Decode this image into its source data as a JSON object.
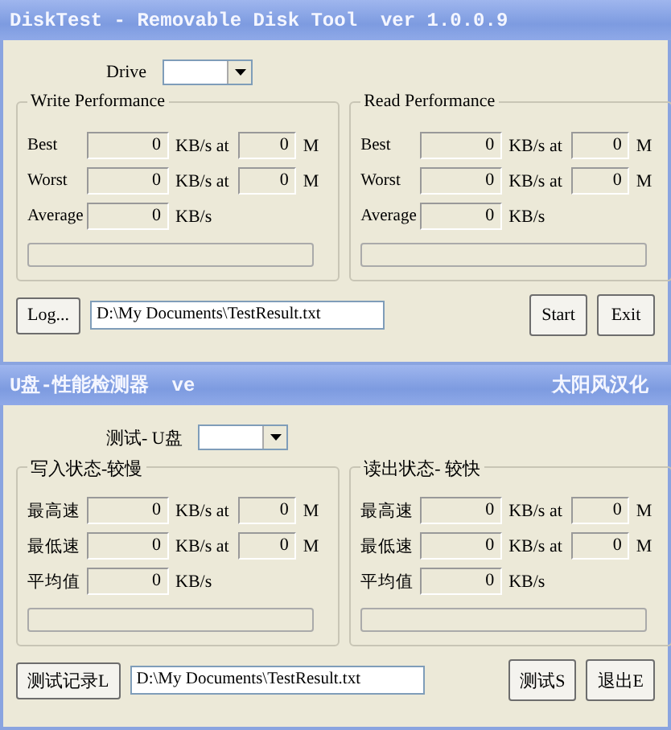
{
  "windows": [
    {
      "title": "DiskTest - Removable Disk Tool  ver 1.0.0.9",
      "drive_label": "Drive",
      "groups": [
        {
          "title": "Write Performance",
          "rows": [
            {
              "label": "Best",
              "value": "0",
              "unit": "KB/s at",
              "at_value": "0",
              "at_unit": "M"
            },
            {
              "label": "Worst",
              "value": "0",
              "unit": "KB/s at",
              "at_value": "0",
              "at_unit": "M"
            },
            {
              "label": "Average",
              "value": "0",
              "unit": "KB/s"
            }
          ],
          "progress": {
            "level": 0
          }
        },
        {
          "title": "Read Performance",
          "rows": [
            {
              "label": "Best",
              "value": "0",
              "unit": "KB/s at",
              "at_value": "0",
              "at_unit": "M"
            },
            {
              "label": "Worst",
              "value": "0",
              "unit": "KB/s at",
              "at_value": "0",
              "at_unit": "M"
            },
            {
              "label": "Average",
              "value": "0",
              "unit": "KB/s"
            }
          ],
          "progress": {
            "level": 0
          }
        }
      ],
      "log_button": "Log...",
      "log_path": "D:\\My Documents\\TestResult.txt",
      "buttons": [
        "Start",
        "Exit"
      ]
    },
    {
      "title": "U盘-性能检测器  ve",
      "title_right": "太阳风汉化",
      "drive_label": "测试- U盘",
      "groups": [
        {
          "title": "写入状态-较慢",
          "rows": [
            {
              "label": "最高速",
              "value": "0",
              "unit": "KB/s at",
              "at_value": "0",
              "at_unit": "M"
            },
            {
              "label": "最低速",
              "value": "0",
              "unit": "KB/s at",
              "at_value": "0",
              "at_unit": "M"
            },
            {
              "label": "平均值",
              "value": "0",
              "unit": "KB/s"
            }
          ],
          "progress": {
            "level": 0
          }
        },
        {
          "title": "读出状态- 较快",
          "rows": [
            {
              "label": "最高速",
              "value": "0",
              "unit": "KB/s at",
              "at_value": "0",
              "at_unit": "M"
            },
            {
              "label": "最低速",
              "value": "0",
              "unit": "KB/s at",
              "at_value": "0",
              "at_unit": "M"
            },
            {
              "label": "平均值",
              "value": "0",
              "unit": "KB/s"
            }
          ],
          "progress": {
            "level": 0
          }
        }
      ],
      "log_button": "测试记录L",
      "log_path": "D:\\My Documents\\TestResult.txt",
      "buttons": [
        "测试S",
        "退出E"
      ]
    }
  ]
}
